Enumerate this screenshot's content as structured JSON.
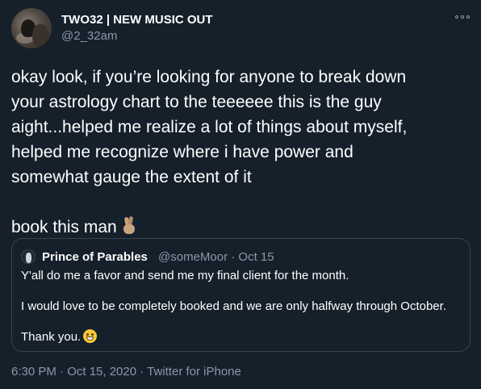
{
  "author": {
    "display_name": "TWO32 | NEW MUSIC OUT",
    "handle": "@2_32am",
    "avatar_icon": "profile-photo"
  },
  "tweet": {
    "lines": [
      "okay look, if you’re looking for anyone to break down",
      "your astrology chart to the teeeeee this is the guy",
      "aight...helped me realize a lot of things about myself,",
      "helped me recognize where i have power and",
      "somewhat gauge the extent of it"
    ],
    "closing": "book this man",
    "closing_emoji": "crossed-fingers-icon"
  },
  "quoted_tweet": {
    "display_name": "Prince of Parables",
    "handle_date": "@someMoor · Oct 15",
    "paragraphs": [
      "Y'all do me a favor and send me my final client for the month.",
      "I would love to be completely booked and we are only halfway through October.",
      "Thank you."
    ],
    "end_emoji": "grinning-face-icon"
  },
  "footer": {
    "meta": "6:30 PM · Oct 15, 2020 · Twitter for iPhone"
  },
  "colors": {
    "background": "#15202b",
    "text": "#ffffff",
    "secondary_text": "#8899a6",
    "border": "#38444d"
  }
}
